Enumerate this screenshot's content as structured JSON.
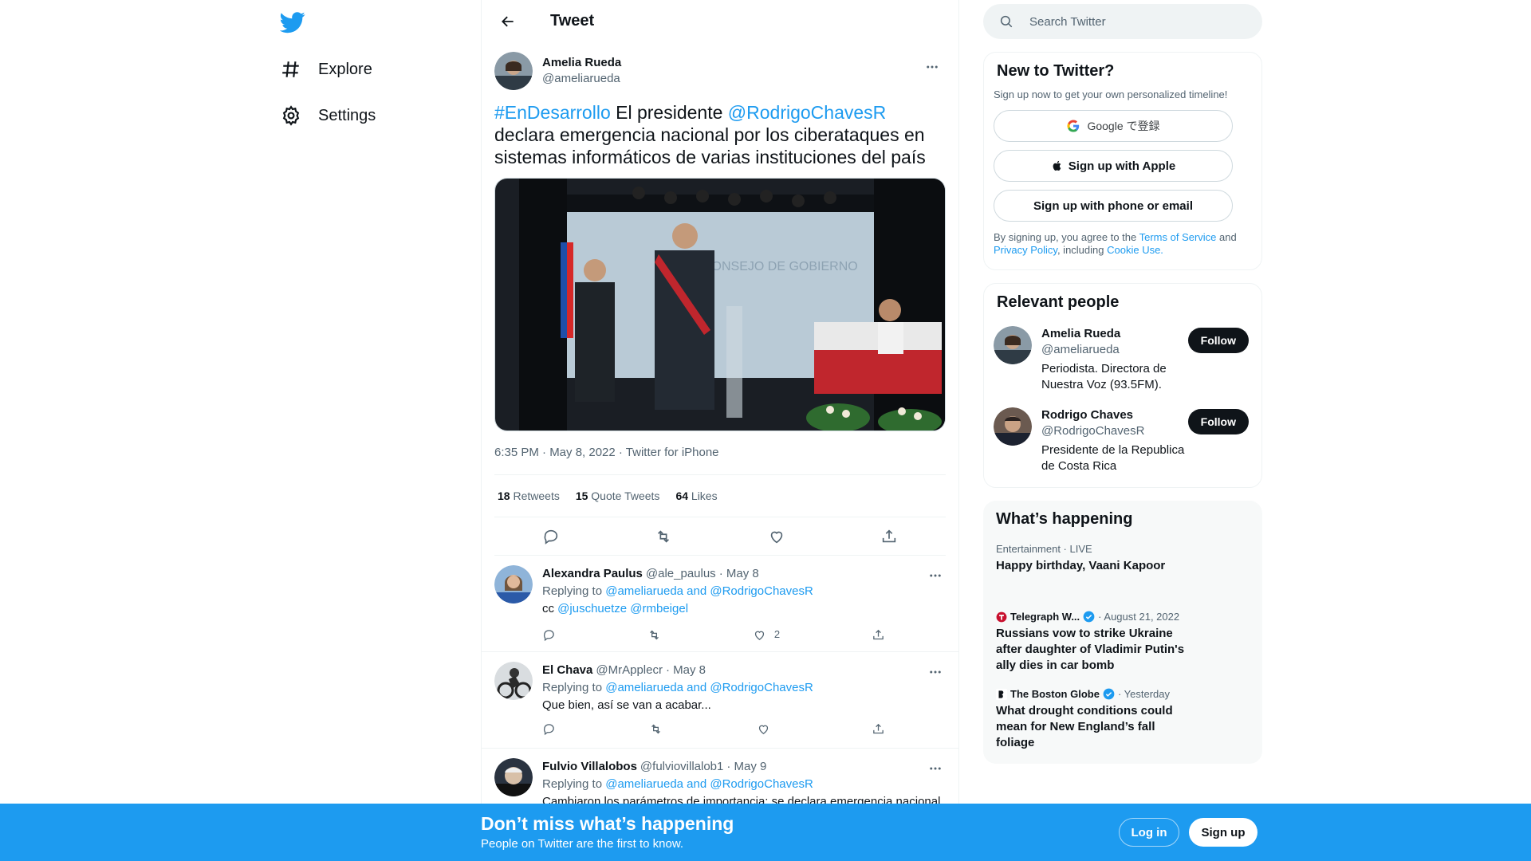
{
  "nav": {
    "logo_icon": "twitter-bird-icon",
    "items": [
      {
        "label": "Explore",
        "icon": "hash-icon"
      },
      {
        "label": "Settings",
        "icon": "gear-icon"
      }
    ]
  },
  "header": {
    "title": "Tweet"
  },
  "tweet": {
    "author_name": "Amelia Rueda",
    "author_handle": "@ameliarueda",
    "hashtag": "#EnDesarrollo",
    "text_1": " El presidente ",
    "mention": "@RodrigoChavesR",
    "text_2": " declara emergencia nacional por los ciberataques en sistemas informáticos de varias instituciones del país",
    "time": "6:35 PM · May 8, 2022 · Twitter for iPhone",
    "retweets": "18",
    "retweets_label": "Retweets",
    "quotes": "15",
    "quotes_label": "Quote Tweets",
    "likes": "64",
    "likes_label": "Likes"
  },
  "replies": [
    {
      "name": "Alexandra Paulus",
      "handle": "@ale_paulus",
      "date": "· May 8",
      "replying_label": "Replying to ",
      "replying_to": "@ameliarueda and @RodrigoChavesR",
      "text_prefix": "cc ",
      "text_mentions": "@juschuetze @rmbeigel",
      "likes": "2"
    },
    {
      "name": "El Chava",
      "handle": "@MrApplecr",
      "date": "· May 8",
      "replying_label": "Replying to ",
      "replying_to": "@ameliarueda and @RodrigoChavesR",
      "text": "Que bien, así se van a acabar...",
      "likes": ""
    },
    {
      "name": "Fulvio Villalobos",
      "handle": "@fulviovillalob1",
      "date": "· May 9",
      "replying_label": "Replying to ",
      "replying_to": "@ameliarueda and @RodrigoChavesR",
      "text": "Cambiaron los parámetros de importancia: se declara emergencia nacional",
      "likes": ""
    }
  ],
  "search": {
    "placeholder": "Search Twitter"
  },
  "new_to_twitter": {
    "title": "New to Twitter?",
    "subtitle": "Sign up now to get your own personalized timeline!",
    "google_label": "Google で登録",
    "apple_label": "Sign up with Apple",
    "email_label": "Sign up with phone or email",
    "legal_1": "By signing up, you agree to the ",
    "terms": "Terms of Service",
    "legal_2": " and ",
    "privacy": "Privacy Policy",
    "legal_3": ", including ",
    "cookie": "Cookie Use."
  },
  "relevant": {
    "title": "Relevant people",
    "people": [
      {
        "name": "Amelia Rueda",
        "handle": "@ameliarueda",
        "bio": "Periodista. Directora de Nuestra Voz (93.5FM).",
        "follow": "Follow"
      },
      {
        "name": "Rodrigo Chaves",
        "handle": "@RodrigoChavesR",
        "bio": "Presidente de la Republica de Costa Rica",
        "follow": "Follow"
      }
    ]
  },
  "happening": {
    "title": "What’s happening",
    "trends": [
      {
        "meta": "Entertainment · LIVE",
        "title": "Happy birthday, Vaani Kapoor"
      },
      {
        "source": "Telegraph W...",
        "date": "· August 21, 2022",
        "title": "Russians vow to strike Ukraine after daughter of Vladimir Putin's ally dies in car bomb"
      },
      {
        "source": "The Boston Globe",
        "date": "· Yesterday",
        "title": "What drought conditions could mean for New England’s fall foliage"
      }
    ]
  },
  "bottom_bar": {
    "title": "Don’t miss what’s happening",
    "subtitle": "People on Twitter are the first to know.",
    "login": "Log in",
    "signup": "Sign up"
  },
  "colors": {
    "accent": "#1d9bf0",
    "text": "#0f1419",
    "muted": "#536471"
  }
}
